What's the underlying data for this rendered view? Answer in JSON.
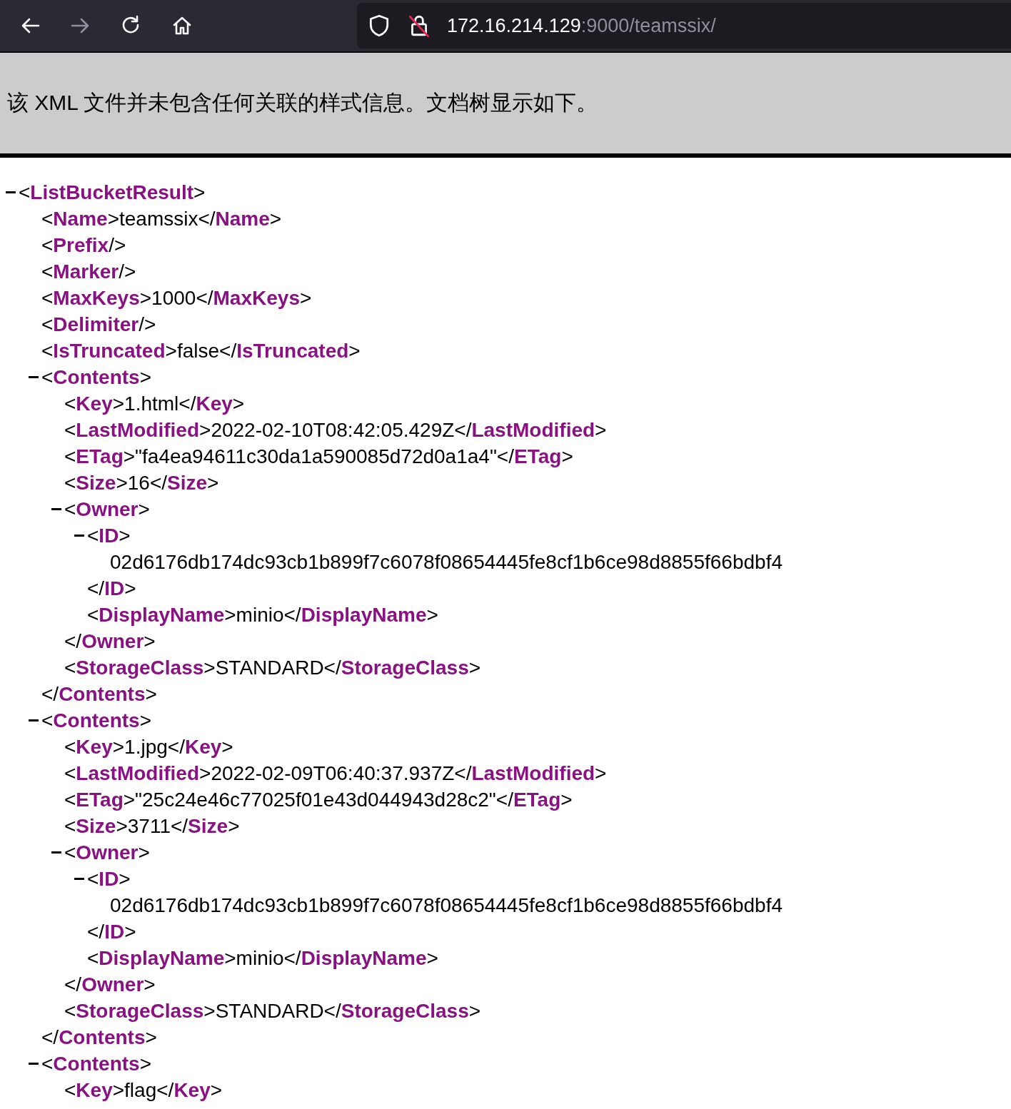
{
  "toolbar": {
    "url_host": "172.16.214.129",
    "url_rest": ":9000/teamssix/"
  },
  "notice": "该 XML 文件并未包含任何关联的样式信息。文档树显示如下。",
  "tree": [
    {
      "kind": "parent",
      "open": "<**ListBucketResult**>",
      "expanded": true,
      "children": [
        {
          "kind": "leaf",
          "line": "<**Name**>teamssix</**Name**>"
        },
        {
          "kind": "leaf",
          "line": "<**Prefix**/>"
        },
        {
          "kind": "leaf",
          "line": "<**Marker**/>"
        },
        {
          "kind": "leaf",
          "line": "<**MaxKeys**>1000</**MaxKeys**>"
        },
        {
          "kind": "leaf",
          "line": "<**Delimiter**/>"
        },
        {
          "kind": "leaf",
          "line": "<**IsTruncated**>false</**IsTruncated**>"
        },
        {
          "kind": "parent",
          "open": "<**Contents**>",
          "close": "</**Contents**>",
          "expanded": true,
          "children": [
            {
              "kind": "leaf",
              "line": "<**Key**>1.html</**Key**>"
            },
            {
              "kind": "leaf",
              "line": "<**LastModified**>2022-02-10T08:42:05.429Z</**LastModified**>"
            },
            {
              "kind": "leaf",
              "line": "<**ETag**>\"fa4ea94611c30da1a590085d72d0a1a4\"</**ETag**>"
            },
            {
              "kind": "leaf",
              "line": "<**Size**>16</**Size**>"
            },
            {
              "kind": "parent",
              "open": "<**Owner**>",
              "close": "</**Owner**>",
              "expanded": true,
              "children": [
                {
                  "kind": "parent",
                  "open": "<**ID**>",
                  "close": "</**ID**>",
                  "expanded": true,
                  "children": [
                    {
                      "kind": "text",
                      "line": "02d6176db174dc93cb1b899f7c6078f08654445fe8cf1b6ce98d8855f66bdbf4"
                    }
                  ]
                },
                {
                  "kind": "leaf",
                  "line": "<**DisplayName**>minio</**DisplayName**>"
                }
              ]
            },
            {
              "kind": "leaf",
              "line": "<**StorageClass**>STANDARD</**StorageClass**>"
            }
          ]
        },
        {
          "kind": "parent",
          "open": "<**Contents**>",
          "close": "</**Contents**>",
          "expanded": true,
          "children": [
            {
              "kind": "leaf",
              "line": "<**Key**>1.jpg</**Key**>"
            },
            {
              "kind": "leaf",
              "line": "<**LastModified**>2022-02-09T06:40:37.937Z</**LastModified**>"
            },
            {
              "kind": "leaf",
              "line": "<**ETag**>\"25c24e46c77025f01e43d044943d28c2\"</**ETag**>"
            },
            {
              "kind": "leaf",
              "line": "<**Size**>3711</**Size**>"
            },
            {
              "kind": "parent",
              "open": "<**Owner**>",
              "close": "</**Owner**>",
              "expanded": true,
              "children": [
                {
                  "kind": "parent",
                  "open": "<**ID**>",
                  "close": "</**ID**>",
                  "expanded": true,
                  "children": [
                    {
                      "kind": "text",
                      "line": "02d6176db174dc93cb1b899f7c6078f08654445fe8cf1b6ce98d8855f66bdbf4"
                    }
                  ]
                },
                {
                  "kind": "leaf",
                  "line": "<**DisplayName**>minio</**DisplayName**>"
                }
              ]
            },
            {
              "kind": "leaf",
              "line": "<**StorageClass**>STANDARD</**StorageClass**>"
            }
          ]
        },
        {
          "kind": "parent",
          "open": "<**Contents**>",
          "expanded": true,
          "children": [
            {
              "kind": "leaf",
              "line": "<**Key**>flag</**Key**>"
            }
          ]
        }
      ]
    }
  ]
}
